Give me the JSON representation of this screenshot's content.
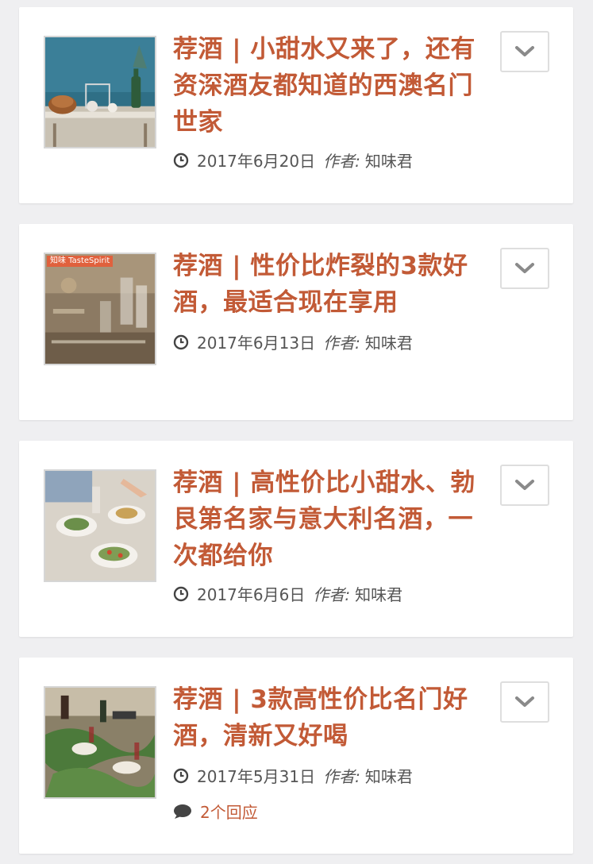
{
  "posts": [
    {
      "title": "荐酒 | 小甜水又来了，还有资深酒友都知道的西澳名门世家",
      "date": "2017年6月20日",
      "author_label": "作者:",
      "author": "知味君",
      "thumb_badge": "",
      "comments": ""
    },
    {
      "title": "荐酒 | 性价比炸裂的3款好酒，最适合现在享用",
      "date": "2017年6月13日",
      "author_label": "作者:",
      "author": "知味君",
      "thumb_badge": "知味 TasteSpirit",
      "comments": ""
    },
    {
      "title": "荐酒 | 高性价比小甜水、勃艮第名家与意大利名酒，一次都给你",
      "date": "2017年6月6日",
      "author_label": "作者:",
      "author": "知味君",
      "thumb_badge": "",
      "comments": ""
    },
    {
      "title": "荐酒 | 3款高性价比名门好酒，清新又好喝",
      "date": "2017年5月31日",
      "author_label": "作者:",
      "author": "知味君",
      "thumb_badge": "",
      "comments": "2个回应"
    }
  ],
  "colors": {
    "title": "#c25a36",
    "meta": "#555555",
    "background": "#efeff1",
    "card": "#ffffff"
  },
  "icons": {
    "date": "clock-icon",
    "comments": "speech-bubble-icon",
    "expand": "chevron-down-icon"
  }
}
